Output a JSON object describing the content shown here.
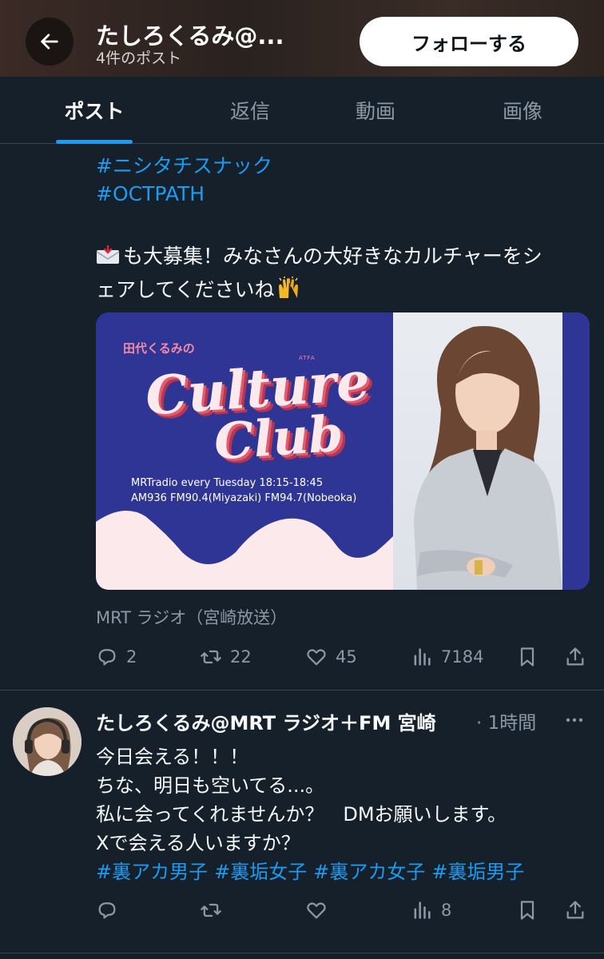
{
  "header": {
    "title": "たしろくるみ@...",
    "subtitle": "4件のポスト",
    "follow_label": "フォローする"
  },
  "tabs": [
    {
      "label": "ポスト",
      "active": true
    },
    {
      "label": "返信",
      "active": false
    },
    {
      "label": "動画",
      "active": false
    },
    {
      "label": "画像",
      "active": false
    }
  ],
  "post1": {
    "hashtags": [
      "#ニシタチスナック",
      "#OCTPATH"
    ],
    "text_line1": "も大募集！みなさんの大好きなカルチャーをシ",
    "text_line2": "ェアしてくださいね",
    "card": {
      "small_title": "田代くるみの",
      "title1": "Culture",
      "title2": "Club",
      "info1": "MRTradio every Tuesday 18:15-18:45",
      "info2": "AM936 FM90.4(Miyazaki) FM94.7(Nobeoka)",
      "logo": "ATFA"
    },
    "source": "MRT ラジオ（宮崎放送）",
    "stats": {
      "replies": "2",
      "reposts": "22",
      "likes": "45",
      "views": "7184"
    }
  },
  "post2": {
    "author": "たしろくるみ@MRT ラジオ＋FM 宮崎",
    "time": "· 1時間",
    "lines": [
      "今日会える！！！",
      "ちな、明日も空いてる...。",
      "私に会ってくれませんか？　DMお願いします。",
      "Xで会える人いますか？"
    ],
    "hashtags": [
      "#裏アカ男子",
      "#裏垢女子",
      "#裏アカ女子",
      "#裏垢男子"
    ],
    "stats": {
      "views": "8"
    }
  },
  "colors": {
    "background": "#15202b",
    "accent": "#1d9bf0",
    "muted": "#8b98a5",
    "card_navy": "#2f3594"
  }
}
